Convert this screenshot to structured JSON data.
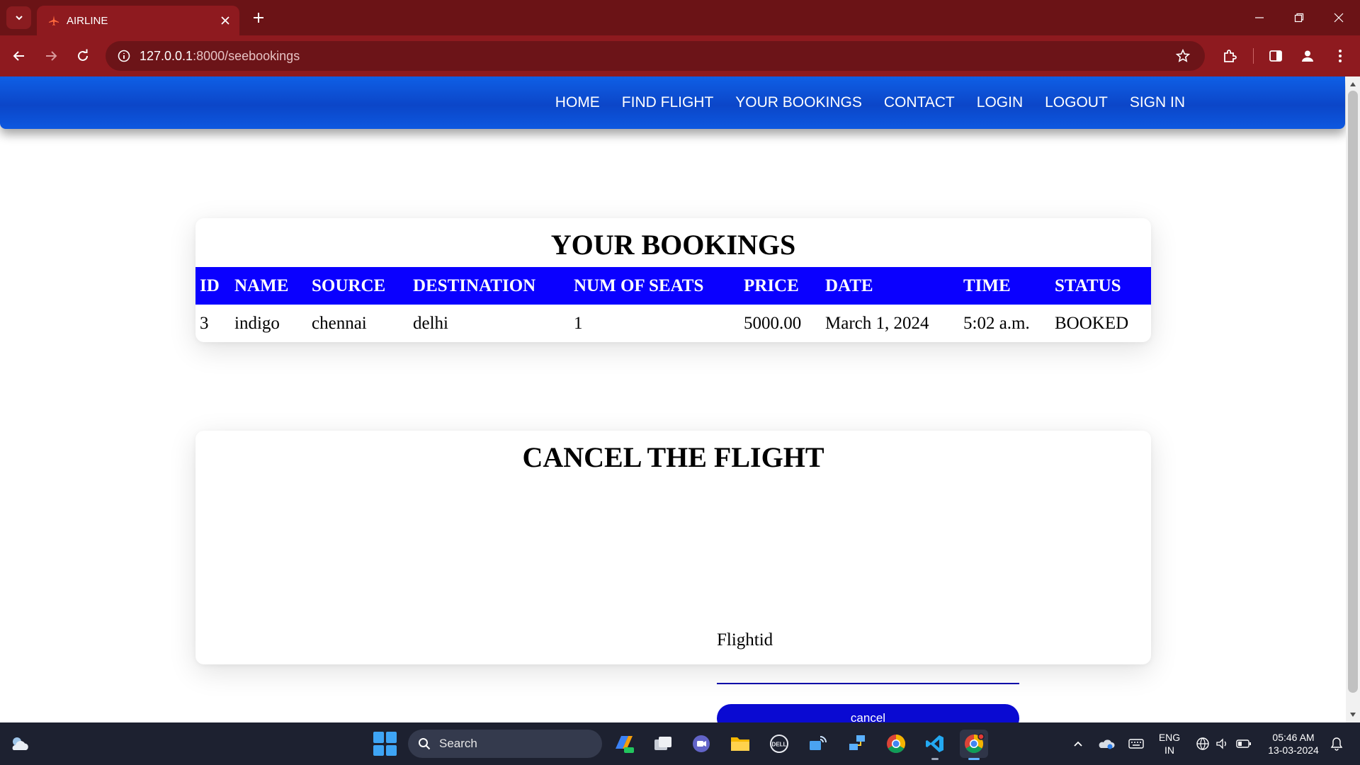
{
  "browser": {
    "tab_title": "AIRLINE",
    "url_host": "127.0.0.1",
    "url_path": ":8000/seebookings"
  },
  "nav": {
    "links": [
      "HOME",
      "FIND FLIGHT",
      "YOUR BOOKINGS",
      "CONTACT",
      "LOGIN",
      "LOGOUT",
      "SIGN IN"
    ]
  },
  "bookings": {
    "title": "YOUR BOOKINGS",
    "columns": [
      "ID",
      "NAME",
      "SOURCE",
      "DESTINATION",
      "NUM OF SEATS",
      "PRICE",
      "DATE",
      "TIME",
      "STATUS"
    ],
    "rows": [
      [
        "3",
        "indigo",
        "chennai",
        "delhi",
        "1",
        "5000.00",
        "March 1, 2024",
        "5:02 a.m.",
        "BOOKED"
      ]
    ]
  },
  "cancel": {
    "title": "CANCEL THE FLIGHT",
    "field_label": "Flightid",
    "field_value": "",
    "button_label": "cancel"
  },
  "taskbar": {
    "search_label": "Search",
    "language": "ENG",
    "region": "IN",
    "time": "05:46 AM",
    "date": "13-03-2024"
  },
  "colors": {
    "browser_frame": "#6b1316",
    "nav_blue": "#0c46c8",
    "table_header": "#0a00ff",
    "cancel_button": "#0a0ad2"
  }
}
